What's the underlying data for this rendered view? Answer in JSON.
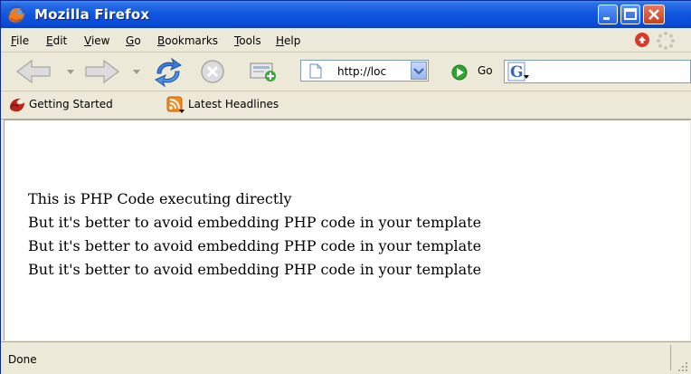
{
  "window": {
    "title": "Mozilla Firefox"
  },
  "menubar": {
    "items": [
      {
        "label": "File",
        "accel": "F",
        "rest": "ile"
      },
      {
        "label": "Edit",
        "accel": "E",
        "rest": "dit"
      },
      {
        "label": "View",
        "accel": "V",
        "rest": "iew"
      },
      {
        "label": "Go",
        "accel": "G",
        "rest": "o"
      },
      {
        "label": "Bookmarks",
        "accel": "B",
        "rest": "ookmarks"
      },
      {
        "label": "Tools",
        "accel": "T",
        "rest": "ools"
      },
      {
        "label": "Help",
        "accel": "H",
        "rest": "elp"
      }
    ]
  },
  "navbar": {
    "url": "http://loc",
    "go_label": "Go",
    "search_value": ""
  },
  "bookmarks": {
    "items": [
      {
        "label": "Getting Started",
        "icon": "firefox-icon"
      },
      {
        "label": "Latest Headlines",
        "icon": "rss-feed-icon"
      }
    ]
  },
  "content": {
    "lines": [
      "This is PHP Code executing directly",
      "But it's better to avoid embedding PHP code in your template",
      "But it's better to avoid embedding PHP code in your template",
      "But it's better to avoid embedding PHP code in your template"
    ]
  },
  "status": {
    "text": "Done"
  },
  "colors": {
    "titlebar": "#0a4cd6",
    "chrome": "#ece9d8",
    "go_green": "#2fa52f",
    "stop_red": "#d42b2b"
  }
}
